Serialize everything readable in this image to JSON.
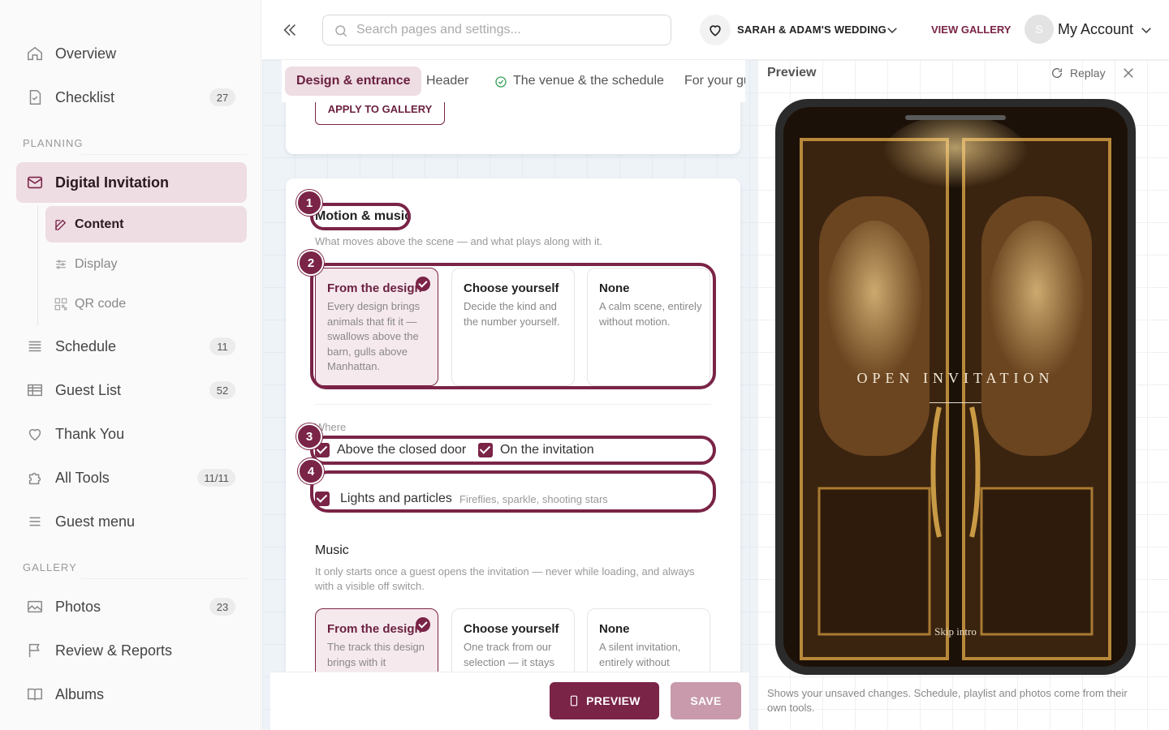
{
  "sidebar": {
    "items_top": [
      {
        "label": "Overview"
      },
      {
        "label": "Checklist",
        "count": "27"
      }
    ],
    "planning_label": "PLANNING",
    "digital_invitation": "Digital Invitation",
    "sub": [
      {
        "label": "Content"
      },
      {
        "label": "Display"
      },
      {
        "label": "QR code"
      }
    ],
    "items_mid": [
      {
        "label": "Schedule",
        "count": "11"
      },
      {
        "label": "Guest List",
        "count": "52"
      },
      {
        "label": "Thank You"
      },
      {
        "label": "All Tools",
        "count": "11/11"
      },
      {
        "label": "Guest menu"
      }
    ],
    "gallery_label": "GALLERY",
    "items_gallery": [
      {
        "label": "Photos",
        "count": "23"
      },
      {
        "label": "Review & Reports"
      },
      {
        "label": "Albums"
      }
    ]
  },
  "topbar": {
    "search_placeholder": "Search pages and settings...",
    "wedding": "SARAH & ADAM'S WEDDING",
    "view_gallery": "VIEW GALLERY",
    "avatar_initial": "S",
    "account": "My Account"
  },
  "tabs": [
    "Design & entrance",
    "Header",
    "The venue & the schedule",
    "For your gu"
  ],
  "apply_btn": "APPLY TO GALLERY",
  "motion": {
    "title": "Motion & music",
    "desc": "What moves above the scene — and what plays along with it.",
    "options": [
      {
        "title": "From the design",
        "desc": "Every design brings animals that fit it — swallows above the barn, gulls above Manhattan."
      },
      {
        "title": "Choose yourself",
        "desc": "Decide the kind and the number yourself."
      },
      {
        "title": "None",
        "desc": "A calm scene, entirely without motion."
      }
    ],
    "where_label": "Where",
    "where": [
      "Above the closed door",
      "On the invitation"
    ],
    "lights": "Lights and particles",
    "lights_hint": "Fireflies, sparkle, shooting stars"
  },
  "music": {
    "title": "Music",
    "desc": "It only starts once a guest opens the invitation — never while loading, and always with a visible off switch.",
    "options": [
      {
        "title": "From the design",
        "desc": "The track this design brings with it"
      },
      {
        "title": "Choose yourself",
        "desc": "One track from our selection — it stays"
      },
      {
        "title": "None",
        "desc": "A silent invitation, entirely without"
      }
    ]
  },
  "badges": [
    "1",
    "2",
    "3",
    "4"
  ],
  "footer": {
    "preview": "PREVIEW",
    "save": "SAVE"
  },
  "preview": {
    "title": "Preview",
    "replay": "Replay",
    "open_text": "OPEN INVITATION",
    "skip": "Skip intro",
    "note": "Shows your unsaved changes. Schedule, playlist and photos come from their own tools."
  },
  "colors": {
    "accent": "#7a2447",
    "accent_soft": "#eedde3",
    "save_disabled": "#c89aab"
  }
}
